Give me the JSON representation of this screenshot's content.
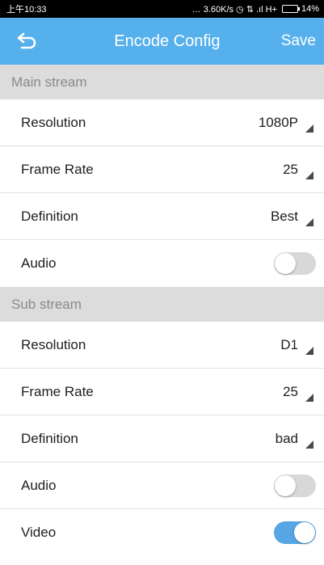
{
  "status_bar": {
    "time": "上午10:33",
    "indicators": "… 3.60K/s ◷ ⇅ .ıl H+",
    "battery": "14%"
  },
  "header": {
    "back_icon": "back-arrow-icon",
    "title": "Encode Config",
    "save_label": "Save",
    "color": "#56b0ec"
  },
  "main_stream": {
    "title": "Main stream",
    "resolution": {
      "label": "Resolution",
      "value": "1080P"
    },
    "frame_rate": {
      "label": "Frame Rate",
      "value": "25"
    },
    "definition": {
      "label": "Definition",
      "value": "Best"
    },
    "audio": {
      "label": "Audio",
      "enabled": false
    }
  },
  "sub_stream": {
    "title": "Sub stream",
    "resolution": {
      "label": "Resolution",
      "value": "D1"
    },
    "frame_rate": {
      "label": "Frame Rate",
      "value": "25"
    },
    "definition": {
      "label": "Definition",
      "value": "bad"
    },
    "audio": {
      "label": "Audio",
      "enabled": false
    },
    "video": {
      "label": "Video",
      "enabled": true
    }
  },
  "colors": {
    "toggle_on": "#56a6e4",
    "toggle_off": "#d8d8d8",
    "section_bg": "#dcdcdc"
  }
}
